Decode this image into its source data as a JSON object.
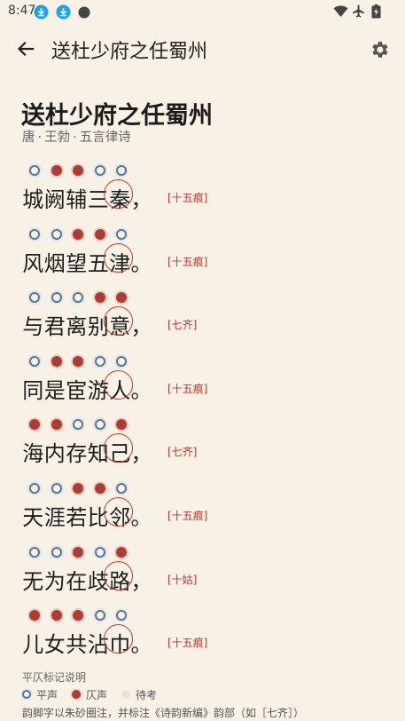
{
  "status_bar": {
    "time": "8:47"
  },
  "app_bar": {
    "title": "送杜少府之任蜀州"
  },
  "poem": {
    "title": "送杜少府之任蜀州",
    "dynasty": "唐",
    "author": "王勃",
    "form": "五言律诗",
    "lines": [
      {
        "chars": [
          "城",
          "阙",
          "辅",
          "三"
        ],
        "rhyme": "秦",
        "punct": "，",
        "tones": [
          "ping",
          "ze",
          "ze",
          "ping",
          "ping"
        ],
        "yunbu": "[十五痕]"
      },
      {
        "chars": [
          "风",
          "烟",
          "望",
          "五"
        ],
        "rhyme": "津",
        "punct": "。",
        "tones": [
          "ping",
          "ping",
          "ze",
          "ze",
          "ping"
        ],
        "yunbu": "[十五痕]"
      },
      {
        "chars": [
          "与",
          "君",
          "离",
          "别"
        ],
        "rhyme": "意",
        "punct": "，",
        "tones": [
          "ping",
          "ping",
          "ping",
          "ze",
          "ze"
        ],
        "yunbu": "[七齐]"
      },
      {
        "chars": [
          "同",
          "是",
          "宦",
          "游"
        ],
        "rhyme": "人",
        "punct": "。",
        "tones": [
          "ping",
          "ze",
          "ze",
          "ping",
          "ping"
        ],
        "yunbu": "[十五痕]"
      },
      {
        "chars": [
          "海",
          "内",
          "存",
          "知"
        ],
        "rhyme": "己",
        "punct": "，",
        "tones": [
          "ze",
          "ze",
          "ping",
          "ping",
          "ze"
        ],
        "yunbu": "[七齐]"
      },
      {
        "chars": [
          "天",
          "涯",
          "若",
          "比"
        ],
        "rhyme": "邻",
        "punct": "。",
        "tones": [
          "ping",
          "ping",
          "ze",
          "ze",
          "ping"
        ],
        "yunbu": "[十五痕]"
      },
      {
        "chars": [
          "无",
          "为",
          "在",
          "歧"
        ],
        "rhyme": "路",
        "punct": "，",
        "tones": [
          "ping",
          "ping",
          "ze",
          "ping",
          "ze"
        ],
        "yunbu": "[十姑]"
      },
      {
        "chars": [
          "儿",
          "女",
          "共",
          "沾"
        ],
        "rhyme": "巾",
        "punct": "。",
        "tones": [
          "ze",
          "ze",
          "ze",
          "ping",
          "ping"
        ],
        "yunbu": "[十五痕]"
      }
    ]
  },
  "legend": {
    "title": "平仄标记说明",
    "ping_label": "平声",
    "ze_label": "仄声",
    "pending_label": "待考",
    "note": "韵脚字以朱砂圈注，并标注《诗韵新编》韵部（如［七齐］）"
  },
  "colors": {
    "background": "#f7f1e6",
    "ping": "#5a7795",
    "ze": "#b23a34",
    "accent": "#c0392b"
  }
}
